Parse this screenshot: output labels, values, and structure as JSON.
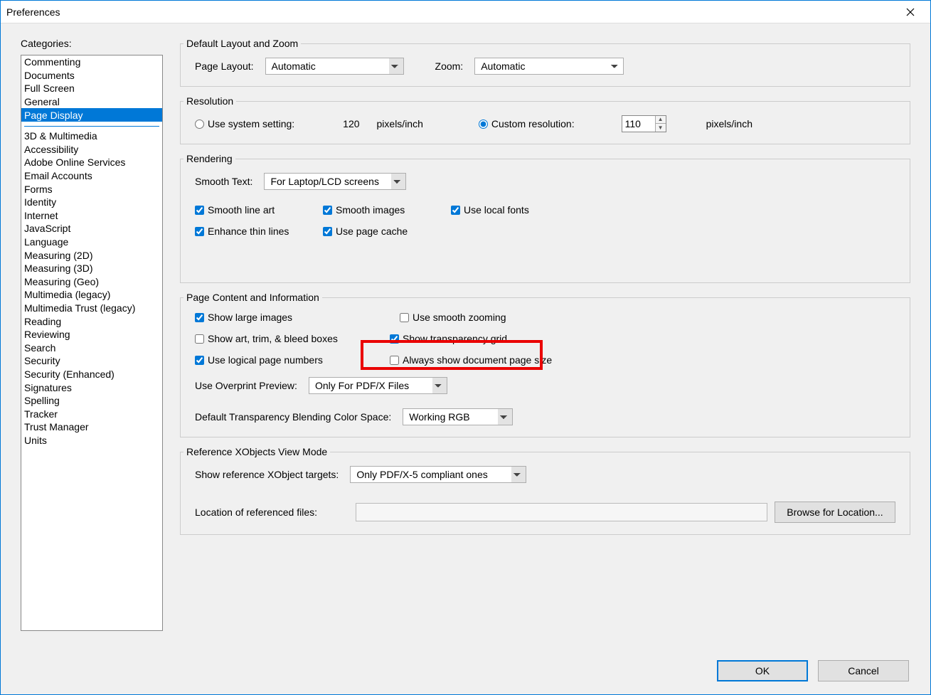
{
  "window": {
    "title": "Preferences"
  },
  "sidebar": {
    "label": "Categories:",
    "group1": [
      "Commenting",
      "Documents",
      "Full Screen",
      "General",
      "Page Display"
    ],
    "selected": "Page Display",
    "group2": [
      "3D & Multimedia",
      "Accessibility",
      "Adobe Online Services",
      "Email Accounts",
      "Forms",
      "Identity",
      "Internet",
      "JavaScript",
      "Language",
      "Measuring (2D)",
      "Measuring (3D)",
      "Measuring (Geo)",
      "Multimedia (legacy)",
      "Multimedia Trust (legacy)",
      "Reading",
      "Reviewing",
      "Search",
      "Security",
      "Security (Enhanced)",
      "Signatures",
      "Spelling",
      "Tracker",
      "Trust Manager",
      "Units"
    ]
  },
  "layoutZoom": {
    "legend": "Default Layout and Zoom",
    "pageLayoutLabel": "Page Layout:",
    "pageLayoutValue": "Automatic",
    "zoomLabel": "Zoom:",
    "zoomValue": "Automatic"
  },
  "resolution": {
    "legend": "Resolution",
    "sysLabel": "Use system setting:",
    "sysValue": "120",
    "unit": "pixels/inch",
    "customLabel": "Custom resolution:",
    "customValue": "110"
  },
  "rendering": {
    "legend": "Rendering",
    "smoothTextLabel": "Smooth Text:",
    "smoothTextValue": "For Laptop/LCD screens",
    "smoothLineArt": "Smooth line art",
    "smoothImages": "Smooth images",
    "useLocalFonts": "Use local fonts",
    "enhanceThin": "Enhance thin lines",
    "pageCache": "Use page cache"
  },
  "pageContent": {
    "legend": "Page Content and Information",
    "largeImages": "Show large images",
    "smoothZoom": "Use smooth zooming",
    "artTrim": "Show art, trim, & bleed boxes",
    "transGrid": "Show transparency grid",
    "logicalPage": "Use logical page numbers",
    "docPageSize": "Always show document page size",
    "overprintLabel": "Use Overprint Preview:",
    "overprintValue": "Only For PDF/X Files",
    "blendLabel": "Default Transparency Blending Color Space:",
    "blendValue": "Working RGB"
  },
  "xobjects": {
    "legend": "Reference XObjects View Mode",
    "targetsLabel": "Show reference XObject targets:",
    "targetsValue": "Only PDF/X-5 compliant ones",
    "locationLabel": "Location of referenced files:",
    "locationValue": "",
    "browse": "Browse for Location..."
  },
  "buttons": {
    "ok": "OK",
    "cancel": "Cancel"
  }
}
